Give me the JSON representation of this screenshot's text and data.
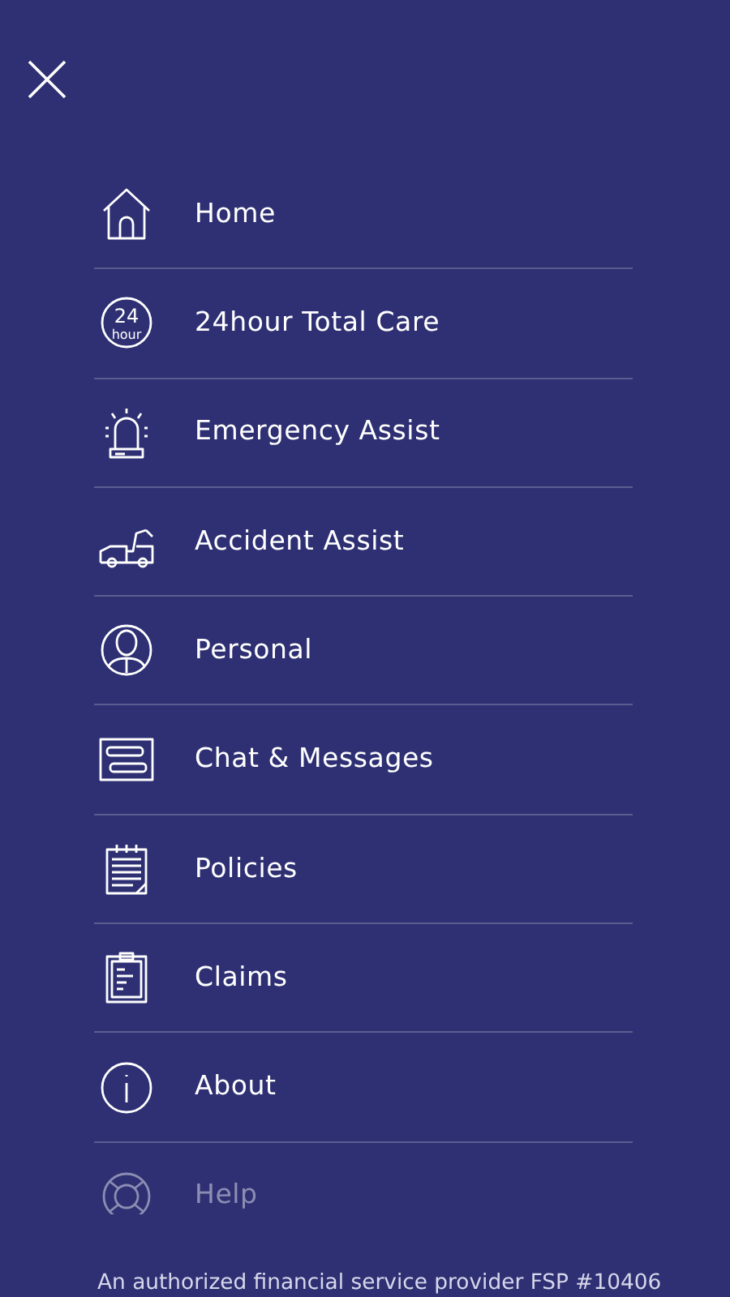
{
  "menu": [
    {
      "kind": "home",
      "label": "Home",
      "faded": false
    },
    {
      "kind": "clock24",
      "label": "24hour Total Care",
      "faded": false,
      "icon_text": [
        "24",
        "hour"
      ]
    },
    {
      "kind": "siren",
      "label": "Emergency Assist",
      "faded": false
    },
    {
      "kind": "tow",
      "label": "Accident Assist",
      "faded": false
    },
    {
      "kind": "person",
      "label": "Personal",
      "faded": false
    },
    {
      "kind": "chat",
      "label": "Chat & Messages",
      "faded": false
    },
    {
      "kind": "notepad",
      "label": "Policies",
      "faded": false
    },
    {
      "kind": "clipboard",
      "label": "Claims",
      "faded": false
    },
    {
      "kind": "info",
      "label": "About",
      "faded": false
    },
    {
      "kind": "lifebuoy",
      "label": "Help",
      "faded": true
    }
  ],
  "footer": "An authorized financial service provider FSP #10406"
}
